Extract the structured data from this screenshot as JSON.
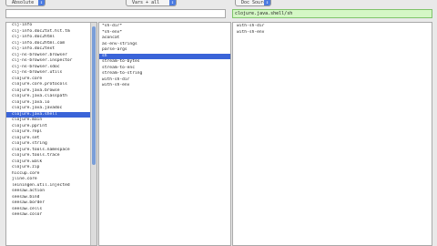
{
  "toolbar": {
    "namespace_popup": "Absolute",
    "vars_popup": "Vars + all",
    "source_popup": "Doc Source"
  },
  "search": {
    "left": "",
    "middle": "",
    "right": "clojure.java.shell/sh"
  },
  "namespaces": [
    "clj-info",
    "clj-info.doc2txt.hlt.tm",
    "clj-info.doc2html",
    "clj-info.doc2html.com",
    "clj-info.doc2text",
    "clj-ns-browser.browser",
    "clj-ns-browser.inspector",
    "clj-ns-browser.sdoc",
    "clj-ns-browser.utils",
    "clojure.core",
    "clojure.core.protocols",
    "clojure.java.browse",
    "clojure.java.classpath",
    "clojure.java.io",
    "clojure.java.javadoc",
    "clojure.java.shell",
    "clojure.main",
    "clojure.pprint",
    "clojure.repl",
    "clojure.set",
    "clojure.string",
    "clojure.tools.namespace",
    "clojure.tools.trace",
    "clojure.walk",
    "clojure.zip",
    "hiccup.core",
    "jline.core",
    "leiningen.util.injected",
    "seesaw.action",
    "seesaw.bind",
    "seesaw.border",
    "seesaw.cells",
    "seesaw.color"
  ],
  "namespace_selected_index": 15,
  "vars": [
    "*sh-dir*",
    "*sh-env*",
    "aconcat",
    "as-env-strings",
    "parse-args",
    "sh",
    "stream-to-bytes",
    "stream-to-enc",
    "stream-to-string",
    "with-sh-dir",
    "with-sh-env"
  ],
  "var_selected_index": 5,
  "doc_lines": [
    "with-sh-dir",
    "with-sh-env"
  ]
}
